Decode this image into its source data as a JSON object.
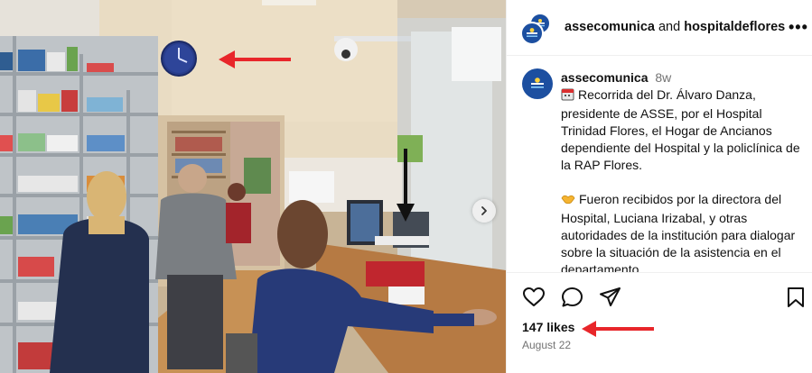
{
  "post_header": {
    "account1": "assecomunica",
    "connector": "and",
    "account2": "hospitaldeflores",
    "more_label": "•••"
  },
  "caption": {
    "username": "assecomunica",
    "time_ago": "8w",
    "paragraph1_emoji": "calendar-icon",
    "paragraph1": "Recorrida del Dr. Álvaro Danza, presidente de ASSE, por el Hospital Trinidad Flores, el Hogar de Ancianos dependiente del Hospital y la policlínica de la RAP Flores.",
    "paragraph2_emoji": "handshake-icon",
    "paragraph2": "Fueron recibidos por la directora del Hospital, Luciana Irizabal, y otras autoridades de la institución para dialogar sobre la situación de la asistencia en el departamento."
  },
  "stats": {
    "likes": "147 likes",
    "date": "August 22"
  },
  "colors": {
    "brand_blue": "#1c4fa0",
    "annotation_red": "#e8262a",
    "muted_text": "#737373"
  },
  "icons": {
    "like": "heart-icon",
    "comment": "comment-icon",
    "share": "share-icon",
    "save": "bookmark-icon",
    "next": "chevron-right-icon"
  }
}
